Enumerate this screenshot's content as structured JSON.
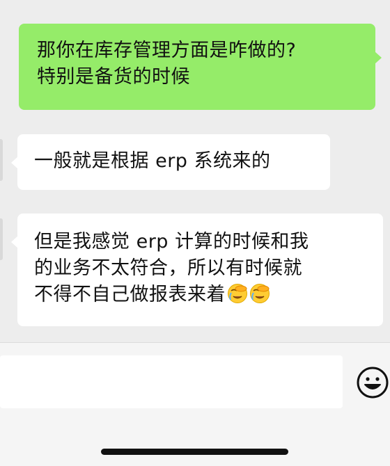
{
  "chat": {
    "messages": [
      {
        "direction": "outgoing",
        "lines": [
          "那你在库存管理方面是咋做的?",
          "特别是备货的时候"
        ]
      },
      {
        "direction": "incoming",
        "lines": [
          "一般就是根据 erp 系统来的"
        ]
      },
      {
        "direction": "incoming",
        "lines": [
          "但是我感觉 erp 计算的时候和我",
          "的业务不太符合，所以有时候就",
          "不得不自己做报表来着"
        ],
        "trailing_emojis": [
          "face-palm-emoji",
          "face-palm-emoji"
        ]
      }
    ]
  },
  "input_bar": {
    "text_value": "",
    "emoji_button_icon": "smiley-face-icon"
  },
  "colors": {
    "chat_background": "#ededed",
    "outgoing_bubble": "#95ec69",
    "incoming_bubble": "#ffffff",
    "input_bar_background": "#f5f5f5",
    "text": "#111111"
  }
}
